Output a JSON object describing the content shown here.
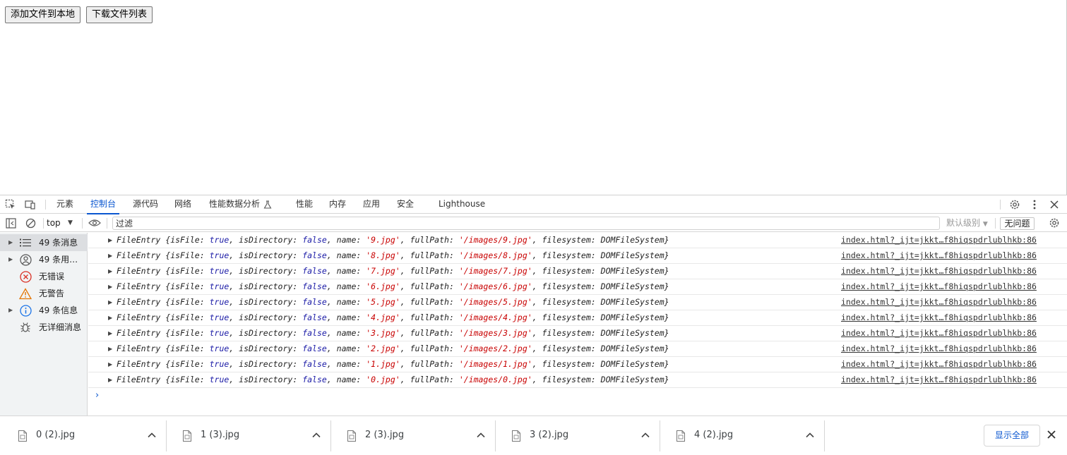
{
  "page": {
    "buttons": [
      "添加文件到本地",
      "下载文件列表"
    ]
  },
  "devtools": {
    "tabs": [
      "元素",
      "控制台",
      "源代码",
      "网络",
      "性能数据分析",
      "性能",
      "内存",
      "应用",
      "安全",
      "Lighthouse"
    ],
    "active_tab": "控制台",
    "toolbar": {
      "context": "top",
      "filter_placeholder": "过滤",
      "levels": "默认级别",
      "issues": "无问题"
    },
    "sidebar": [
      {
        "label": "49 条消息",
        "icon": "list-icon",
        "expandable": true,
        "selected": true
      },
      {
        "label": "49 条用户…",
        "icon": "user-icon",
        "expandable": true,
        "selected": false
      },
      {
        "label": "无错误",
        "icon": "error-icon",
        "expandable": false,
        "selected": false
      },
      {
        "label": "无警告",
        "icon": "warning-icon",
        "expandable": false,
        "selected": false
      },
      {
        "label": "49 条信息",
        "icon": "info-icon",
        "expandable": true,
        "selected": false
      },
      {
        "label": "无详细消息",
        "icon": "bug-icon",
        "expandable": false,
        "selected": false
      }
    ],
    "console": {
      "source": "index.html?_ijt=jkkt…f8hiqspdrlublhkb:86",
      "entries": [
        {
          "name": "'9.jpg'",
          "fullPath": "'/images/9.jpg'"
        },
        {
          "name": "'8.jpg'",
          "fullPath": "'/images/8.jpg'"
        },
        {
          "name": "'7.jpg'",
          "fullPath": "'/images/7.jpg'"
        },
        {
          "name": "'6.jpg'",
          "fullPath": "'/images/6.jpg'"
        },
        {
          "name": "'5.jpg'",
          "fullPath": "'/images/5.jpg'"
        },
        {
          "name": "'4.jpg'",
          "fullPath": "'/images/4.jpg'"
        },
        {
          "name": "'3.jpg'",
          "fullPath": "'/images/3.jpg'"
        },
        {
          "name": "'2.jpg'",
          "fullPath": "'/images/2.jpg'"
        },
        {
          "name": "'1.jpg'",
          "fullPath": "'/images/1.jpg'"
        },
        {
          "name": "'0.jpg'",
          "fullPath": "'/images/0.jpg'"
        }
      ],
      "tokens": {
        "type": "FileEntry",
        "open": "{",
        "isFile_key": "isFile",
        "isFile_val": "true",
        "isDirectory_key": "isDirectory",
        "isDirectory_val": "false",
        "name_key": "name",
        "fullPath_key": "fullPath",
        "filesystem_key": "filesystem",
        "filesystem_val": "DOMFileSystem",
        "close": "}"
      }
    }
  },
  "download_bar": {
    "items": [
      "0 (2).jpg",
      "1 (3).jpg",
      "2 (3).jpg",
      "3 (2).jpg",
      "4 (2).jpg"
    ],
    "show_all": "显示全部"
  },
  "colors": {
    "accent": "#0b57d0",
    "keyword": "#1a1aa6",
    "string": "#c80000",
    "error": "#d93025",
    "warning": "#e37400",
    "info": "#1a73e8"
  }
}
